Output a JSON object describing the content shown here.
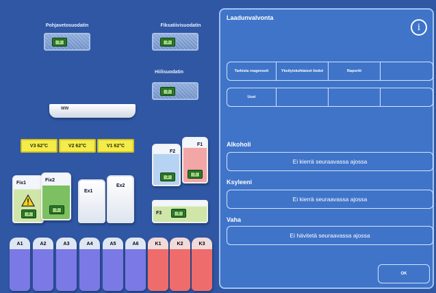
{
  "baths": {
    "pohjavetosuodatin": {
      "label": "Pohjavetosuodatin",
      "tag": "3"
    },
    "fiksatiivisuodatin": {
      "label": "Fiksatiivisuodatin",
      "tag": "3"
    },
    "hiilisuodatin": {
      "label": "Hiilisuodatin",
      "tag": "3"
    }
  },
  "wax_tray": {
    "label": "WW"
  },
  "heaters": [
    {
      "label": "V3 62°C"
    },
    {
      "label": "V2 62°C"
    },
    {
      "label": "V1 62°C"
    }
  ],
  "bottles": {
    "fix1": {
      "label": "Fix1",
      "tag": "3"
    },
    "fix2": {
      "label": "Fix2",
      "tag": "3"
    },
    "ex1": {
      "label": "Ex1"
    },
    "ex2": {
      "label": "Ex2"
    },
    "f1": {
      "label": "F1",
      "tag": "3"
    },
    "f2": {
      "label": "F2",
      "tag": "3"
    },
    "f3": {
      "label": "F3",
      "tag": "3"
    }
  },
  "reagents": [
    {
      "label": "A1",
      "color": "#7b79e6"
    },
    {
      "label": "A2",
      "color": "#7b79e6"
    },
    {
      "label": "A3",
      "color": "#7b79e6"
    },
    {
      "label": "A4",
      "color": "#7b79e6"
    },
    {
      "label": "A5",
      "color": "#7b79e6"
    },
    {
      "label": "A6",
      "color": "#7b79e6"
    },
    {
      "label": "K1",
      "color": "#ef6c6c"
    },
    {
      "label": "K2",
      "color": "#ef6c6c"
    },
    {
      "label": "K3",
      "color": "#ef6c6c"
    }
  ],
  "panel": {
    "title": "Laadunvalvonta",
    "info_icon": "info-icon",
    "grid_header": [
      "Tarkista reagenssit",
      "Yksityiskohtaiset tiedot",
      "Raportit",
      ""
    ],
    "grid_row2": [
      "Uusi",
      "",
      "",
      ""
    ],
    "sections": [
      {
        "label": "Alkoholi",
        "button": "Ei kierrä seuraavassa ajossa"
      },
      {
        "label": "Ksyleeni",
        "button": "Ei kierrä seuraavassa ajossa"
      },
      {
        "label": "Vaha",
        "button": "Ei hävitetä seuraavassa ajossa"
      }
    ],
    "ok_label": "OK"
  },
  "colors": {
    "background": "#2f57a4",
    "panel": "#3f74c9",
    "heater": "#f3ec4a",
    "alcohol": "#7b79e6",
    "xylene": "#ef6c6c",
    "tag_green": "#2b7a2b"
  }
}
